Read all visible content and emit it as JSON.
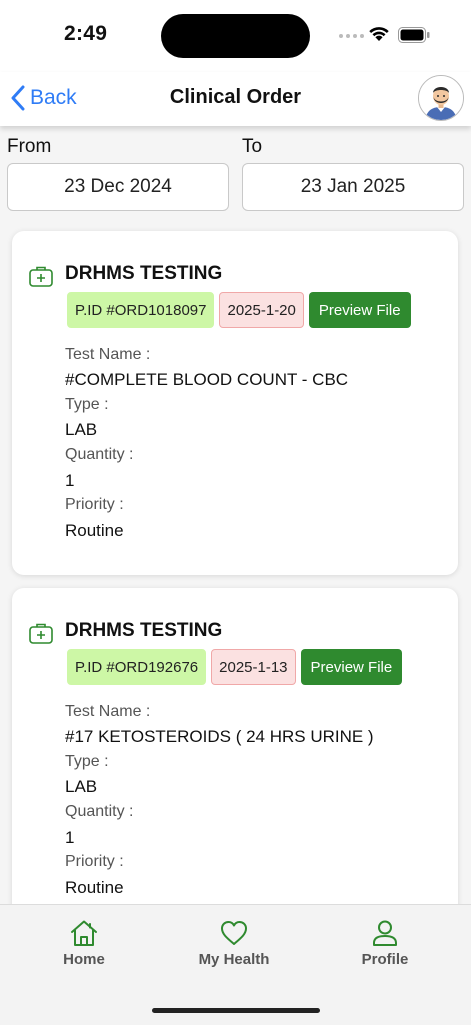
{
  "status_bar": {
    "time": "2:49"
  },
  "nav": {
    "back_label": "Back",
    "title": "Clinical Order"
  },
  "filters": {
    "from_label": "From",
    "from_value": "23 Dec 2024",
    "to_label": "To",
    "to_value": "23 Jan 2025"
  },
  "orders": [
    {
      "facility": "DRHMS TESTING",
      "pid": "P.ID #ORD1018097",
      "date": "2025-1-20",
      "preview_label": "Preview File",
      "test_name_label": "Test Name :",
      "test_name": "#COMPLETE BLOOD COUNT - CBC",
      "type_label": "Type :",
      "type": "LAB",
      "quantity_label": "Quantity :",
      "quantity": "1",
      "priority_label": "Priority :",
      "priority": "Routine"
    },
    {
      "facility": "DRHMS TESTING",
      "pid": "P.ID #ORD192676",
      "date": "2025-1-13",
      "preview_label": "Preview File",
      "test_name_label": "Test Name :",
      "test_name": "#17 KETOSTEROIDS ( 24 HRS URINE )",
      "type_label": "Type :",
      "type": "LAB",
      "quantity_label": "Quantity :",
      "quantity": "1",
      "priority_label": "Priority :",
      "priority": "Routine"
    }
  ],
  "tab_bar": {
    "items": [
      {
        "label": "Home",
        "icon": "home-icon"
      },
      {
        "label": "My Health",
        "icon": "heart-icon"
      },
      {
        "label": "Profile",
        "icon": "user-icon"
      }
    ]
  },
  "colors": {
    "accent_blue": "#2f7cf6",
    "brand_green": "#2f8a2f",
    "pid_tag_bg": "#cdf7a6",
    "date_tag_bg": "#fbe1e1",
    "date_tag_border": "#f0a8a8"
  }
}
